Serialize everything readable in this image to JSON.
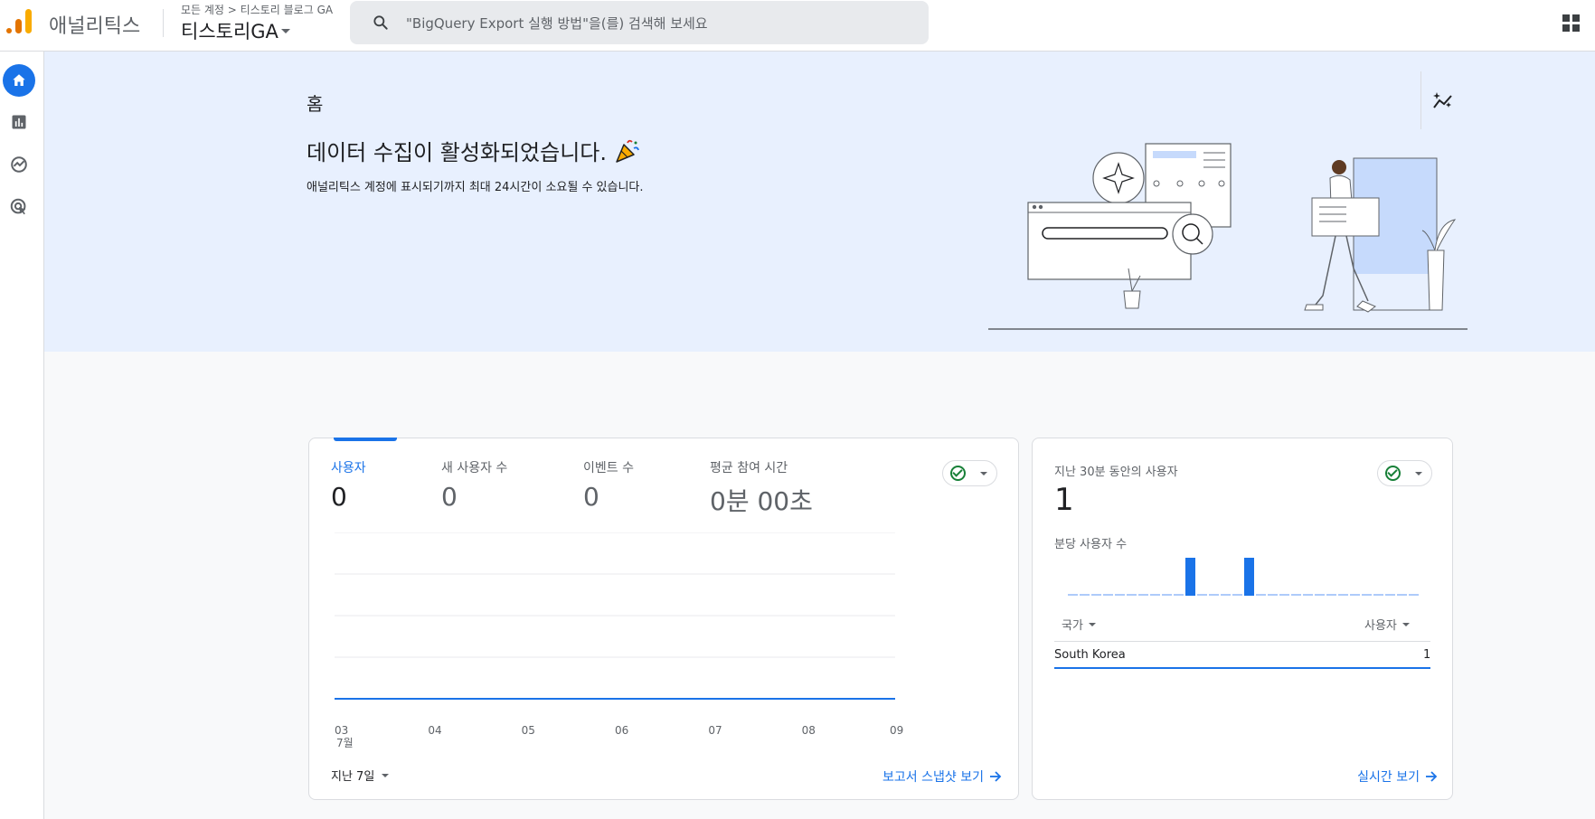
{
  "header": {
    "app_name": "애널리틱스",
    "breadcrumb": "모든 계정 > 티스토리 블로그 GA",
    "property": "티스토리GA",
    "search_placeholder": "\"BigQuery Export 실행 방법\"을(를) 검색해 보세요"
  },
  "hero": {
    "page_title": "홈",
    "heading": "데이터 수집이 활성화되었습니다.",
    "subtitle": "애널리틱스 계정에 표시되기까지 최대 24시간이 소요될 수 있습니다."
  },
  "overview": {
    "metrics": [
      {
        "label": "사용자",
        "value": "0"
      },
      {
        "label": "새 사용자 수",
        "value": "0"
      },
      {
        "label": "이벤트 수",
        "value": "0"
      },
      {
        "label": "평균 참여 시간",
        "value": "0분 00초"
      }
    ],
    "month_label": "7월",
    "range_label": "지난 7일",
    "link_label": "보고서 스냅샷 보기"
  },
  "realtime": {
    "title": "지난 30분 동안의 사용자",
    "value": "1",
    "per_minute_label": "분당 사용자 수",
    "col_country": "국가",
    "col_users": "사용자",
    "rows": [
      {
        "country": "South Korea",
        "users": "1"
      }
    ],
    "link_label": "실시간 보기"
  },
  "colors": {
    "accent": "#1a73e8",
    "success": "#188038",
    "hero_bg": "#e8f0fe"
  },
  "chart_data": [
    {
      "type": "line",
      "x": [
        "03",
        "04",
        "05",
        "06",
        "07",
        "08",
        "09"
      ],
      "series": [
        {
          "values": [
            0,
            0,
            0,
            0,
            0,
            0,
            0
          ]
        }
      ],
      "grid": true
    },
    {
      "type": "bar",
      "values": [
        0,
        0,
        0,
        0,
        0,
        0,
        0,
        0,
        0,
        0,
        1,
        0,
        0,
        0,
        0,
        1,
        0,
        0,
        0,
        0,
        0,
        0,
        0,
        0,
        0,
        0,
        0,
        0,
        0,
        0
      ]
    }
  ]
}
